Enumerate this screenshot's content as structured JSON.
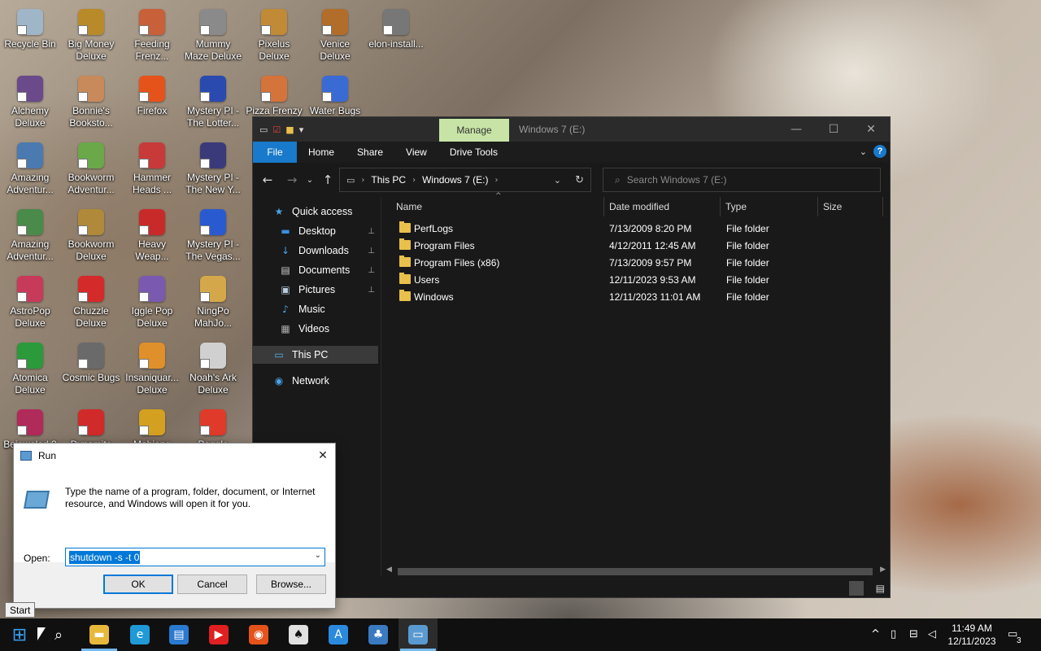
{
  "desktop": {
    "icons": [
      {
        "label": "Recycle Bin",
        "icon": "recycle-bin-icon",
        "color": "#9fb6c9"
      },
      {
        "label": "Big Money\nDeluxe",
        "icon": "money-bag-icon",
        "color": "#b98a2a"
      },
      {
        "label": "Feeding\nFrenz...",
        "icon": "fish-icon",
        "color": "#c8603a"
      },
      {
        "label": "Mummy\nMaze Deluxe",
        "icon": "mummy-icon",
        "color": "#8a8a8a"
      },
      {
        "label": "Pixelus\nDeluxe",
        "icon": "pixelus-icon",
        "color": "#c08a36"
      },
      {
        "label": "Venice\nDeluxe",
        "icon": "gondola-icon",
        "color": "#b26d2a"
      },
      {
        "label": "elon-install...",
        "icon": "installer-icon",
        "color": "#777777"
      },
      {
        "label": "Alchemy\nDeluxe",
        "icon": "alchemy-icon",
        "color": "#6a4a8a"
      },
      {
        "label": "Bonnie's\nBooksto...",
        "icon": "bonnie-icon",
        "color": "#c88a5a"
      },
      {
        "label": "Firefox",
        "icon": "firefox-icon",
        "color": "#e5531a"
      },
      {
        "label": "Mystery PI -\nThe Lotter...",
        "icon": "mystery-pi-icon",
        "color": "#2a4ab0"
      },
      {
        "label": "Pizza Frenzy",
        "icon": "pizza-icon",
        "color": "#d4733a"
      },
      {
        "label": "Water Bugs",
        "icon": "water-bugs-icon",
        "color": "#3a6ad4"
      },
      {
        "label": "Amazing\nAdventur...",
        "icon": "amazing-adventures-icon",
        "color": "#4a7ab0"
      },
      {
        "label": "Bookworm\nAdventur...",
        "icon": "bookworm-icon",
        "color": "#6aa84a"
      },
      {
        "label": "Hammer\nHeads ...",
        "icon": "hammer-heads-icon",
        "color": "#c83a3a"
      },
      {
        "label": "Mystery PI -\nThe New Y...",
        "icon": "mystery-pi-icon",
        "color": "#3a3a7a"
      },
      {
        "label": "Amazing\nAdventur...",
        "icon": "amazing-adventures-icon",
        "color": "#4a8a4a"
      },
      {
        "label": "Bookworm\nDeluxe",
        "icon": "bookworm-icon",
        "color": "#b08a3a"
      },
      {
        "label": "Heavy\nWeap...",
        "icon": "heavy-weapon-icon",
        "color": "#c82a2a"
      },
      {
        "label": "Mystery PI -\nThe Vegas...",
        "icon": "mystery-pi-icon",
        "color": "#2a5ad0"
      },
      {
        "label": "AstroPop\nDeluxe",
        "icon": "astropop-icon",
        "color": "#c83a5a"
      },
      {
        "label": "Chuzzle\nDeluxe",
        "icon": "chuzzle-icon",
        "color": "#d42a2a"
      },
      {
        "label": "Iggle Pop\nDeluxe",
        "icon": "iggle-pop-icon",
        "color": "#7a5ab0"
      },
      {
        "label": "NingPo\nMahJo...",
        "icon": "mahjong-icon",
        "color": "#d4a84a"
      },
      {
        "label": "Atomica\nDeluxe",
        "icon": "atomica-icon",
        "color": "#2a9a3a"
      },
      {
        "label": "Cosmic Bugs",
        "icon": "cosmic-bugs-icon",
        "color": "#6a6a6a"
      },
      {
        "label": "Insaniquar...\nDeluxe",
        "icon": "insaniquarium-icon",
        "color": "#e0902a"
      },
      {
        "label": "Noah's Ark\nDeluxe",
        "icon": "noahs-ark-icon",
        "color": "#d0d0d0"
      },
      {
        "label": "Bejeweled 2",
        "icon": "bejeweled-icon",
        "color": "#b02a5a"
      },
      {
        "label": "Dynomite",
        "icon": "dynomite-icon",
        "color": "#d02a2a"
      },
      {
        "label": "Mahjong",
        "icon": "mahjong-icon",
        "color": "#d4a020"
      },
      {
        "label": "Peggle",
        "icon": "peggle-icon",
        "color": "#e03a2a"
      }
    ]
  },
  "explorer": {
    "title": "Windows 7 (E:)",
    "manage_tab": "Manage",
    "ribbon_tabs": [
      "File",
      "Home",
      "Share",
      "View",
      "Drive Tools"
    ],
    "address": {
      "segments": [
        "This PC",
        "Windows 7 (E:)"
      ]
    },
    "search": {
      "placeholder": "Search Windows 7 (E:)"
    },
    "columns": [
      "Name",
      "Date modified",
      "Type",
      "Size"
    ],
    "nav": [
      {
        "label": "Quick access",
        "icon": "star-icon",
        "pinned": false
      },
      {
        "label": "Desktop",
        "icon": "desktop-icon",
        "pinned": true
      },
      {
        "label": "Downloads",
        "icon": "download-icon",
        "pinned": true
      },
      {
        "label": "Documents",
        "icon": "documents-icon",
        "pinned": true
      },
      {
        "label": "Pictures",
        "icon": "pictures-icon",
        "pinned": true
      },
      {
        "label": "Music",
        "icon": "music-icon",
        "pinned": false
      },
      {
        "label": "Videos",
        "icon": "videos-icon",
        "pinned": false
      },
      {
        "label": "This PC",
        "icon": "this-pc-icon",
        "pinned": false
      },
      {
        "label": "Network",
        "icon": "network-icon",
        "pinned": false
      }
    ],
    "files": [
      {
        "name": "PerfLogs",
        "date": "7/13/2009 8:20 PM",
        "type": "File folder"
      },
      {
        "name": "Program Files",
        "date": "4/12/2011 12:45 AM",
        "type": "File folder"
      },
      {
        "name": "Program Files (x86)",
        "date": "7/13/2009 9:57 PM",
        "type": "File folder"
      },
      {
        "name": "Users",
        "date": "12/11/2023 9:53 AM",
        "type": "File folder"
      },
      {
        "name": "Windows",
        "date": "12/11/2023 11:01 AM",
        "type": "File folder"
      }
    ]
  },
  "run": {
    "title": "Run",
    "message": "Type the name of a program, folder, document, or Internet resource, and Windows will open it for you.",
    "open_label": "Open:",
    "value": "shutdown -s -t 0",
    "ok": "OK",
    "cancel": "Cancel",
    "browse": "Browse..."
  },
  "tooltip": "Start",
  "taskbar": {
    "apps": [
      {
        "name": "start-button",
        "icon": "windows-logo-icon",
        "color": "#3a9ff0"
      },
      {
        "name": "search-button",
        "icon": "search-icon",
        "color": "transparent"
      },
      {
        "name": "file-explorer-taskbar",
        "icon": "folder-icon",
        "color": "#e8b83a"
      },
      {
        "name": "edge-taskbar",
        "icon": "edge-icon",
        "color": "#1f9ad6"
      },
      {
        "name": "store-taskbar",
        "icon": "store-icon",
        "color": "#2a7ad0"
      },
      {
        "name": "youtube-taskbar",
        "icon": "youtube-icon",
        "color": "#e02020"
      },
      {
        "name": "firefox-taskbar",
        "icon": "firefox-icon",
        "color": "#e5531a"
      },
      {
        "name": "solitaire-taskbar",
        "icon": "cards-icon",
        "color": "#e0e0e0"
      },
      {
        "name": "app-store-taskbar",
        "icon": "app-icon",
        "color": "#2a8ae0"
      },
      {
        "name": "game-taskbar",
        "icon": "game-icon",
        "color": "#3a7ac0"
      },
      {
        "name": "run-taskbar",
        "icon": "run-icon",
        "color": "#5a9ad0"
      }
    ],
    "time": "11:49 AM",
    "date": "12/11/2023",
    "notification_count": "3"
  }
}
